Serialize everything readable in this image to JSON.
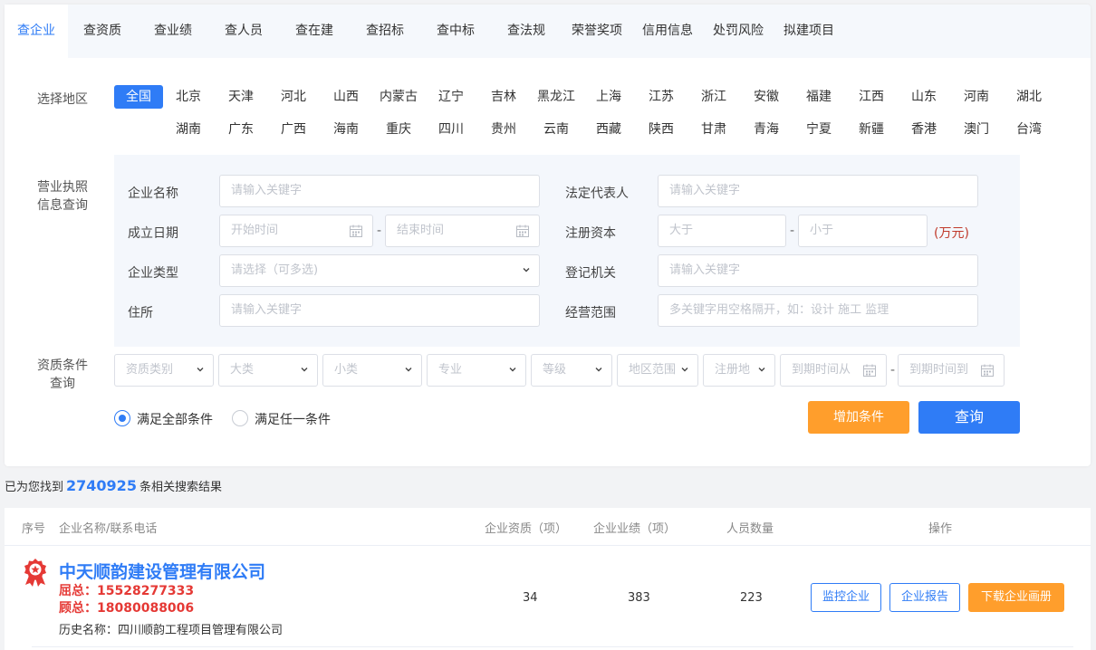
{
  "tabs": [
    {
      "label": "查企业",
      "active": true
    },
    {
      "label": "查资质"
    },
    {
      "label": "查业绩"
    },
    {
      "label": "查人员"
    },
    {
      "label": "查在建"
    },
    {
      "label": "查招标"
    },
    {
      "label": "查中标"
    },
    {
      "label": "查法规"
    },
    {
      "label": "荣誉奖项"
    },
    {
      "label": "信用信息"
    },
    {
      "label": "处罚风险"
    },
    {
      "label": "拟建项目"
    }
  ],
  "region": {
    "label": "选择地区",
    "row1": [
      "全国",
      "北京",
      "天津",
      "河北",
      "山西",
      "内蒙古",
      "辽宁",
      "吉林",
      "黑龙江",
      "上海",
      "江苏",
      "浙江",
      "安徽",
      "福建",
      "江西",
      "山东",
      "河南",
      "湖北"
    ],
    "row2": [
      "湖南",
      "广东",
      "广西",
      "海南",
      "重庆",
      "四川",
      "贵州",
      "云南",
      "西藏",
      "陕西",
      "甘肃",
      "青海",
      "宁夏",
      "新疆",
      "香港",
      "澳门",
      "台湾"
    ],
    "selected": "全国"
  },
  "license": {
    "section_label_1": "营业执照",
    "section_label_2": "信息查询",
    "company_name_label": "企业名称",
    "company_name_placeholder": "请输入关键字",
    "legal_rep_label": "法定代表人",
    "legal_rep_placeholder": "请输入关键字",
    "founded_label": "成立日期",
    "start_placeholder": "开始时间",
    "end_placeholder": "结束时间",
    "capital_label": "注册资本",
    "capital_min_placeholder": "大于",
    "capital_max_placeholder": "小于",
    "capital_unit": "(万元)",
    "type_label": "企业类型",
    "type_placeholder": "请选择（可多选)",
    "authority_label": "登记机关",
    "authority_placeholder": "请输入关键字",
    "address_label": "住所",
    "address_placeholder": "请输入关键字",
    "scope_label": "经营范围",
    "scope_placeholder": "多关键字用空格隔开，如：设计 施工 监理",
    "dash": "-"
  },
  "qualification": {
    "section_label_1": "资质条件",
    "section_label_2": "查询",
    "selects": [
      "资质类别",
      "大类",
      "小类",
      "专业",
      "等级",
      "地区范围",
      "注册地"
    ],
    "expire_from": "到期时间从",
    "expire_to": "到期时间到",
    "dash": "-",
    "radio_all": "满足全部条件",
    "radio_any": "满足任一条件",
    "add_button": "增加条件",
    "search_button": "查询"
  },
  "results": {
    "prefix": "已为您找到",
    "count": "2740925",
    "suffix": "条相关搜索结果"
  },
  "table": {
    "headers": {
      "index": "序号",
      "name": "企业名称/联系电话",
      "quals": "企业资质（项）",
      "perf": "企业业绩（项）",
      "staff": "人员数量",
      "ops": "操作"
    },
    "rows": [
      {
        "name": "中天顺韵建设管理有限公司",
        "phone1": "屈总：15528277333",
        "phone2": "顾总：18080088006",
        "history": "历史名称：四川顺韵工程项目管理有限公司",
        "quals": "34",
        "perf": "383",
        "staff": "223",
        "btn_monitor": "监控企业",
        "btn_report": "企业报告",
        "btn_download": "下载企业画册"
      }
    ]
  },
  "colors": {
    "accent": "#2f7cf6",
    "orange": "#ff9e2c",
    "red": "#e53935"
  }
}
